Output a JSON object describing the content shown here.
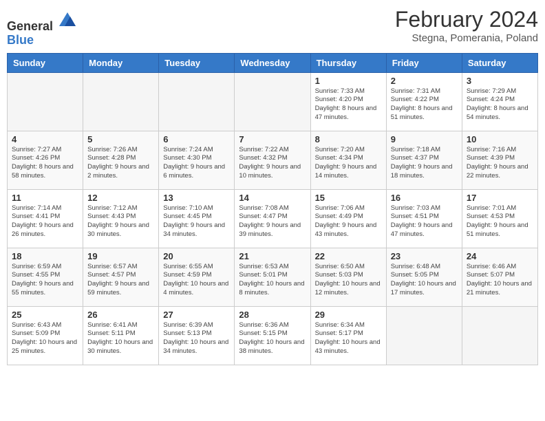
{
  "header": {
    "logo_general": "General",
    "logo_blue": "Blue",
    "main_title": "February 2024",
    "subtitle": "Stegna, Pomerania, Poland"
  },
  "weekdays": [
    "Sunday",
    "Monday",
    "Tuesday",
    "Wednesday",
    "Thursday",
    "Friday",
    "Saturday"
  ],
  "weeks": [
    [
      {
        "day": "",
        "info": ""
      },
      {
        "day": "",
        "info": ""
      },
      {
        "day": "",
        "info": ""
      },
      {
        "day": "",
        "info": ""
      },
      {
        "day": "1",
        "info": "Sunrise: 7:33 AM\nSunset: 4:20 PM\nDaylight: 8 hours\nand 47 minutes."
      },
      {
        "day": "2",
        "info": "Sunrise: 7:31 AM\nSunset: 4:22 PM\nDaylight: 8 hours\nand 51 minutes."
      },
      {
        "day": "3",
        "info": "Sunrise: 7:29 AM\nSunset: 4:24 PM\nDaylight: 8 hours\nand 54 minutes."
      }
    ],
    [
      {
        "day": "4",
        "info": "Sunrise: 7:27 AM\nSunset: 4:26 PM\nDaylight: 8 hours\nand 58 minutes."
      },
      {
        "day": "5",
        "info": "Sunrise: 7:26 AM\nSunset: 4:28 PM\nDaylight: 9 hours\nand 2 minutes."
      },
      {
        "day": "6",
        "info": "Sunrise: 7:24 AM\nSunset: 4:30 PM\nDaylight: 9 hours\nand 6 minutes."
      },
      {
        "day": "7",
        "info": "Sunrise: 7:22 AM\nSunset: 4:32 PM\nDaylight: 9 hours\nand 10 minutes."
      },
      {
        "day": "8",
        "info": "Sunrise: 7:20 AM\nSunset: 4:34 PM\nDaylight: 9 hours\nand 14 minutes."
      },
      {
        "day": "9",
        "info": "Sunrise: 7:18 AM\nSunset: 4:37 PM\nDaylight: 9 hours\nand 18 minutes."
      },
      {
        "day": "10",
        "info": "Sunrise: 7:16 AM\nSunset: 4:39 PM\nDaylight: 9 hours\nand 22 minutes."
      }
    ],
    [
      {
        "day": "11",
        "info": "Sunrise: 7:14 AM\nSunset: 4:41 PM\nDaylight: 9 hours\nand 26 minutes."
      },
      {
        "day": "12",
        "info": "Sunrise: 7:12 AM\nSunset: 4:43 PM\nDaylight: 9 hours\nand 30 minutes."
      },
      {
        "day": "13",
        "info": "Sunrise: 7:10 AM\nSunset: 4:45 PM\nDaylight: 9 hours\nand 34 minutes."
      },
      {
        "day": "14",
        "info": "Sunrise: 7:08 AM\nSunset: 4:47 PM\nDaylight: 9 hours\nand 39 minutes."
      },
      {
        "day": "15",
        "info": "Sunrise: 7:06 AM\nSunset: 4:49 PM\nDaylight: 9 hours\nand 43 minutes."
      },
      {
        "day": "16",
        "info": "Sunrise: 7:03 AM\nSunset: 4:51 PM\nDaylight: 9 hours\nand 47 minutes."
      },
      {
        "day": "17",
        "info": "Sunrise: 7:01 AM\nSunset: 4:53 PM\nDaylight: 9 hours\nand 51 minutes."
      }
    ],
    [
      {
        "day": "18",
        "info": "Sunrise: 6:59 AM\nSunset: 4:55 PM\nDaylight: 9 hours\nand 55 minutes."
      },
      {
        "day": "19",
        "info": "Sunrise: 6:57 AM\nSunset: 4:57 PM\nDaylight: 9 hours\nand 59 minutes."
      },
      {
        "day": "20",
        "info": "Sunrise: 6:55 AM\nSunset: 4:59 PM\nDaylight: 10 hours\nand 4 minutes."
      },
      {
        "day": "21",
        "info": "Sunrise: 6:53 AM\nSunset: 5:01 PM\nDaylight: 10 hours\nand 8 minutes."
      },
      {
        "day": "22",
        "info": "Sunrise: 6:50 AM\nSunset: 5:03 PM\nDaylight: 10 hours\nand 12 minutes."
      },
      {
        "day": "23",
        "info": "Sunrise: 6:48 AM\nSunset: 5:05 PM\nDaylight: 10 hours\nand 17 minutes."
      },
      {
        "day": "24",
        "info": "Sunrise: 6:46 AM\nSunset: 5:07 PM\nDaylight: 10 hours\nand 21 minutes."
      }
    ],
    [
      {
        "day": "25",
        "info": "Sunrise: 6:43 AM\nSunset: 5:09 PM\nDaylight: 10 hours\nand 25 minutes."
      },
      {
        "day": "26",
        "info": "Sunrise: 6:41 AM\nSunset: 5:11 PM\nDaylight: 10 hours\nand 30 minutes."
      },
      {
        "day": "27",
        "info": "Sunrise: 6:39 AM\nSunset: 5:13 PM\nDaylight: 10 hours\nand 34 minutes."
      },
      {
        "day": "28",
        "info": "Sunrise: 6:36 AM\nSunset: 5:15 PM\nDaylight: 10 hours\nand 38 minutes."
      },
      {
        "day": "29",
        "info": "Sunrise: 6:34 AM\nSunset: 5:17 PM\nDaylight: 10 hours\nand 43 minutes."
      },
      {
        "day": "",
        "info": ""
      },
      {
        "day": "",
        "info": ""
      }
    ]
  ]
}
